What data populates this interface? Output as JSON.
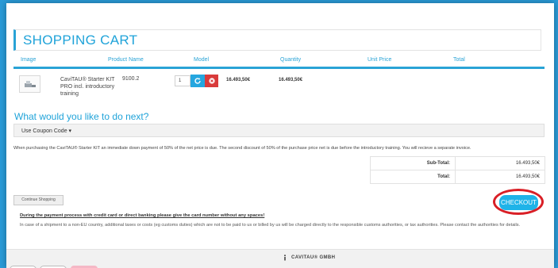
{
  "cart": {
    "title": "SHOPPING CART",
    "columns": [
      "Image",
      "Product Name",
      "Model",
      "Quantity",
      "Unit Price",
      "Total"
    ]
  },
  "item": {
    "name": "CaviTAU® Starter KIT PRO incl. introductory training",
    "model": "9100.2",
    "quantity": "1",
    "unit_price": "16.493,50€",
    "total": "16.493,50€"
  },
  "next": {
    "title": "What would you like to do next?",
    "coupon_label": "Use Coupon Code ▾"
  },
  "notice": "When purchasing the CaviTAU® Starter KIT an immediate down payment of 50% of the net price is due. The second discount of 50% of the purchase price net is due before the introductory training. You will recieve a separate invoice.",
  "totals": {
    "subtotal_label": "Sub-Total:",
    "subtotal_value": "16.493,50€",
    "total_label": "Total:",
    "total_value": "16.493,50€"
  },
  "actions": {
    "continue_label": "Continue Shopping",
    "checkout_label": "CHECKOUT"
  },
  "warnings": {
    "payment": "During the payment process with credit card or direct banking please give the card number without any spaces!",
    "shipping": "In case of a shipment to a non-EU country, additional taxes or costs (eg customs duties) which are not to be paid to us or billed by us will be charged directly to the responsible customs authorities, or tax authorities. Please contact the authorities for details."
  },
  "footer": {
    "brand": "CAVITAU® GMBH"
  },
  "colors": {
    "accent": "#1fa3d9",
    "remove": "#d93b3b",
    "highlight_ring": "#d91f26",
    "background": "#2a9bd8"
  }
}
